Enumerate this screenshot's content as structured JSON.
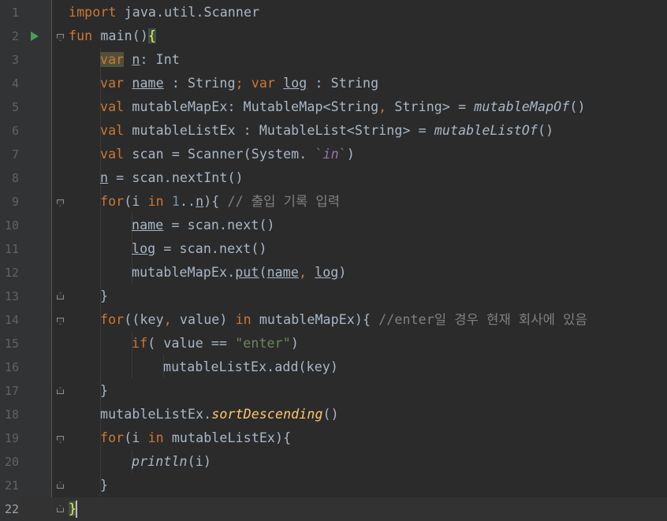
{
  "line_numbers": [
    "1",
    "2",
    "3",
    "4",
    "5",
    "6",
    "7",
    "8",
    "9",
    "10",
    "11",
    "12",
    "13",
    "14",
    "15",
    "16",
    "17",
    "18",
    "19",
    "20",
    "21",
    "22"
  ],
  "code": {
    "l1": {
      "kw": "import",
      "rest": " java.util.Scanner"
    },
    "l2": {
      "kw": "fun",
      "name": " main()",
      "brace": "{"
    },
    "l3": {
      "kw": "var",
      "sp": " ",
      "var": "n",
      "rest": ": Int"
    },
    "l4": {
      "kw1": "var",
      "sp1": " ",
      "v1": "name",
      "mid": " : String",
      "semi": ";",
      "sp2": " ",
      "kw2": "var",
      "sp3": " ",
      "v2": "log",
      "rest": " : String"
    },
    "l5": {
      "kw": "val",
      "rest1": " mutableMapEx: MutableMap<String",
      "comma": ",",
      "rest2": " String> = ",
      "fn": "mutableMapOf",
      "tail": "()"
    },
    "l6": {
      "kw": "val",
      "rest1": " mutableListEx : MutableList<String> = ",
      "fn": "mutableListOf",
      "tail": "()"
    },
    "l7": {
      "kw": "val",
      "rest1": " scan = Scanner(System. ",
      "tick1": "`",
      "in": "in",
      "tick2": "`",
      "tail": ")"
    },
    "l8": {
      "var": "n",
      "rest": " = scan.nextInt()"
    },
    "l9": {
      "kw": "for",
      "open": "(i ",
      "kw2": "in",
      "sp": " ",
      "num": "1",
      "dots": "..",
      "var": "n",
      "close": "){ ",
      "comment": "// 출입 기록 입력"
    },
    "l10": {
      "var": "name",
      "rest": " = scan.next()"
    },
    "l11": {
      "var": "log",
      "rest": " = scan.next()"
    },
    "l12": {
      "pre": "mutableMapEx.",
      "put": "put",
      "open": "(",
      "v1": "name",
      "comma": ",",
      "sp": " ",
      "v2": "log",
      "close": ")"
    },
    "l13": {
      "brace": "}"
    },
    "l14": {
      "kw": "for",
      "open": "((key",
      "comma": ",",
      "mid": " value) ",
      "kw2": "in",
      "rest": " mutableMapEx){ ",
      "comment": "//enter일 경우 현재 회사에 있음"
    },
    "l15": {
      "kw": "if",
      "rest": "( value == ",
      "str": "\"enter\"",
      "close": ")"
    },
    "l16": {
      "rest": "mutableListEx.add(key)"
    },
    "l17": {
      "brace": "}"
    },
    "l18": {
      "pre": "mutableListEx.",
      "fn": "sortDescending",
      "tail": "()"
    },
    "l19": {
      "kw": "for",
      "open": "(i ",
      "kw2": "in",
      "rest": " mutableListEx){"
    },
    "l20": {
      "fn": "println",
      "tail": "(i)"
    },
    "l21": {
      "brace": "}"
    },
    "l22": {
      "brace": "}"
    }
  },
  "colors": {
    "background": "#2b2b2b",
    "gutter": "#313335",
    "keyword": "#cc7832",
    "text": "#a9b7c6",
    "string": "#6a8759",
    "number": "#6897bb",
    "comment": "#808080",
    "function_call": "#ffc66d",
    "escaped_identifier": "#9876aa",
    "run_icon": "#499c54"
  },
  "icons": {
    "run": "run-gutter-icon",
    "fold": "fold-marker-icon"
  }
}
